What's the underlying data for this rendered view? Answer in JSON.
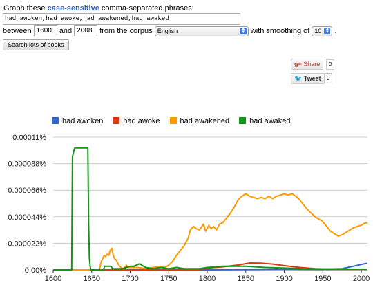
{
  "header": {
    "prefix": "Graph these",
    "highlight": "case-sensitive",
    "suffix": "comma-separated phrases:"
  },
  "phrases_input": {
    "value": "had awoken,had awoke,had awakened,had awaked"
  },
  "controls": {
    "between_label": "between",
    "start_year": "1600",
    "and_label": "and",
    "end_year": "2008",
    "corpus_label": "from the corpus",
    "corpus_value": "English",
    "smoothing_label": "with smoothing of",
    "smoothing_value": "10",
    "period": ".",
    "search_button": "Search lots of books"
  },
  "social": {
    "share_label": "Share",
    "share_count": "0",
    "tweet_label": "Tweet",
    "tweet_count": "0",
    "share_icon": "google-plus-icon",
    "tweet_icon": "twitter-bird-icon"
  },
  "chart_data": {
    "type": "line",
    "xlim": [
      1600,
      2008
    ],
    "ylim": [
      0,
      0.00011
    ],
    "x_ticks": [
      "1600",
      "1650",
      "1700",
      "1750",
      "1800",
      "1850",
      "1900",
      "1950",
      "2000"
    ],
    "y_ticks": [
      "0.00%",
      "0.000022%",
      "0.000044%",
      "0.000066%",
      "0.000088%",
      "0.00011%"
    ],
    "grid": true,
    "legend_position": "top",
    "series": [
      {
        "name": "had awoken",
        "color": "#3366cc",
        "points": [
          [
            1600,
            0
          ],
          [
            1800,
            0
          ],
          [
            1900,
            3e-07
          ],
          [
            1950,
            6e-07
          ],
          [
            1975,
            1e-06
          ],
          [
            1990,
            3e-06
          ],
          [
            2000,
            4.5e-06
          ],
          [
            2008,
            5.5e-06
          ]
        ]
      },
      {
        "name": "had awoke",
        "color": "#dc3912",
        "points": [
          [
            1600,
            0
          ],
          [
            1790,
            0
          ],
          [
            1800,
            1.5e-06
          ],
          [
            1820,
            2.5e-06
          ],
          [
            1840,
            4e-06
          ],
          [
            1855,
            5.7e-06
          ],
          [
            1870,
            5.5e-06
          ],
          [
            1885,
            4.8e-06
          ],
          [
            1900,
            3.5e-06
          ],
          [
            1920,
            2e-06
          ],
          [
            1940,
            1e-06
          ],
          [
            1960,
            5e-07
          ],
          [
            2008,
            4e-07
          ]
        ]
      },
      {
        "name": "had awakened",
        "color": "#ff9900",
        "points": [
          [
            1600,
            0
          ],
          [
            1660,
            0
          ],
          [
            1662,
            6e-06
          ],
          [
            1666,
            1.2e-05
          ],
          [
            1668,
            1.1e-05
          ],
          [
            1670,
            1.3e-05
          ],
          [
            1672,
            1.2e-05
          ],
          [
            1674,
            1.6e-05
          ],
          [
            1676,
            1.8e-05
          ],
          [
            1678,
            1.2e-05
          ],
          [
            1680,
            9e-06
          ],
          [
            1682,
            8e-06
          ],
          [
            1685,
            4e-06
          ],
          [
            1688,
            2e-06
          ],
          [
            1692,
            1e-06
          ],
          [
            1695,
            4e-06
          ],
          [
            1697,
            2e-06
          ],
          [
            1700,
            2e-06
          ],
          [
            1710,
            2e-06
          ],
          [
            1720,
            1e-06
          ],
          [
            1730,
            2e-06
          ],
          [
            1740,
            3e-06
          ],
          [
            1745,
            2e-06
          ],
          [
            1750,
            4e-06
          ],
          [
            1755,
            7e-06
          ],
          [
            1760,
            1.2e-05
          ],
          [
            1765,
            1.6e-05
          ],
          [
            1770,
            2e-05
          ],
          [
            1775,
            2.6e-05
          ],
          [
            1778,
            3.3e-05
          ],
          [
            1782,
            3.6e-05
          ],
          [
            1786,
            3.4e-05
          ],
          [
            1790,
            3.3e-05
          ],
          [
            1795,
            3.8e-05
          ],
          [
            1798,
            3.2e-05
          ],
          [
            1802,
            3.7e-05
          ],
          [
            1805,
            3.4e-05
          ],
          [
            1808,
            3.6e-05
          ],
          [
            1812,
            3.3e-05
          ],
          [
            1816,
            3.8e-05
          ],
          [
            1820,
            3.9e-05
          ],
          [
            1825,
            4.3e-05
          ],
          [
            1830,
            4.7e-05
          ],
          [
            1835,
            5.2e-05
          ],
          [
            1840,
            5.8e-05
          ],
          [
            1845,
            6.1e-05
          ],
          [
            1850,
            6.3e-05
          ],
          [
            1855,
            6.1e-05
          ],
          [
            1860,
            6e-05
          ],
          [
            1865,
            5.9e-05
          ],
          [
            1870,
            6e-05
          ],
          [
            1875,
            5.9e-05
          ],
          [
            1880,
            6.1e-05
          ],
          [
            1885,
            5.9e-05
          ],
          [
            1890,
            6.1e-05
          ],
          [
            1895,
            6.2e-05
          ],
          [
            1900,
            6.3e-05
          ],
          [
            1905,
            6.2e-05
          ],
          [
            1910,
            6.3e-05
          ],
          [
            1915,
            6.1e-05
          ],
          [
            1920,
            5.8e-05
          ],
          [
            1925,
            5.4e-05
          ],
          [
            1930,
            5e-05
          ],
          [
            1935,
            4.7e-05
          ],
          [
            1940,
            4.4e-05
          ],
          [
            1945,
            4.2e-05
          ],
          [
            1950,
            4e-05
          ],
          [
            1955,
            3.6e-05
          ],
          [
            1960,
            3.2e-05
          ],
          [
            1965,
            3e-05
          ],
          [
            1970,
            2.8e-05
          ],
          [
            1975,
            2.9e-05
          ],
          [
            1980,
            3.1e-05
          ],
          [
            1985,
            3.3e-05
          ],
          [
            1990,
            3.5e-05
          ],
          [
            1995,
            3.6e-05
          ],
          [
            2000,
            3.7e-05
          ],
          [
            2005,
            3.9e-05
          ],
          [
            2008,
            3.9e-05
          ]
        ]
      },
      {
        "name": "had awaked",
        "color": "#109618",
        "points": [
          [
            1600,
            0
          ],
          [
            1624,
            0
          ],
          [
            1625,
            9.4e-05
          ],
          [
            1626,
            9.6e-05
          ],
          [
            1627,
            9.9e-05
          ],
          [
            1628,
            0.000101
          ],
          [
            1645,
            0.000101
          ],
          [
            1646,
            4e-05
          ],
          [
            1647,
            1e-05
          ],
          [
            1648,
            3e-06
          ],
          [
            1649,
            0
          ],
          [
            1665,
            0
          ],
          [
            1667,
            3e-06
          ],
          [
            1675,
            3e-06
          ],
          [
            1677,
            1e-06
          ],
          [
            1690,
            1e-06
          ],
          [
            1695,
            2e-06
          ],
          [
            1700,
            3e-06
          ],
          [
            1705,
            3e-06
          ],
          [
            1712,
            5e-06
          ],
          [
            1720,
            2e-06
          ],
          [
            1730,
            1e-06
          ],
          [
            1740,
            2e-06
          ],
          [
            1750,
            1e-06
          ],
          [
            1760,
            2e-06
          ],
          [
            1770,
            1e-06
          ],
          [
            1790,
            1e-06
          ],
          [
            1800,
            2e-06
          ],
          [
            1820,
            3e-06
          ],
          [
            1850,
            3e-06
          ],
          [
            1875,
            2e-06
          ],
          [
            1900,
            1.5e-06
          ],
          [
            1925,
            1e-06
          ],
          [
            1950,
            7e-07
          ],
          [
            2008,
            5e-07
          ]
        ]
      }
    ]
  }
}
